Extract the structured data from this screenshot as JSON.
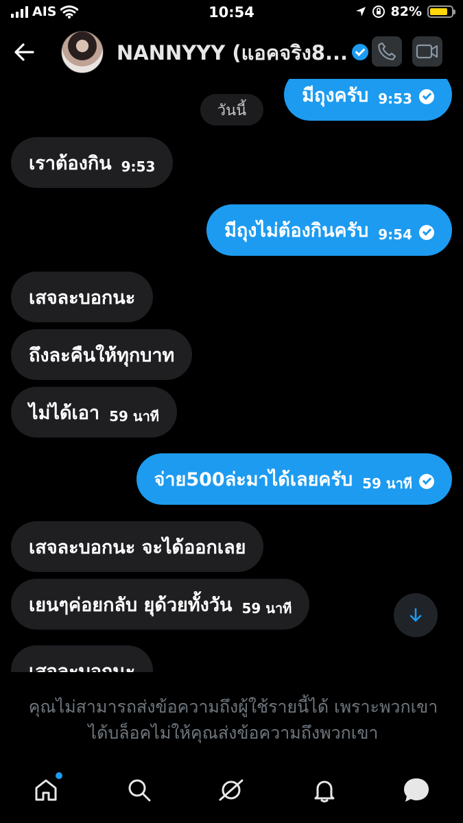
{
  "status_bar": {
    "carrier": "AIS",
    "time": "10:54",
    "battery": "82%",
    "battery_level": 0.82,
    "battery_color": "#ffd60a"
  },
  "header": {
    "title": "NANNYYY (แอคจริง8...",
    "verified": true
  },
  "chat": {
    "date_label": "วันนี้",
    "messages": [
      {
        "dir": "out",
        "text": "มีถุงครับ",
        "time": "9:53",
        "read": true
      },
      {
        "dir": "in",
        "text": "เราต้องกิน",
        "time": "9:53"
      },
      {
        "dir": "out",
        "text": "มีถุงไม่ต้องกินครับ",
        "time": "9:54",
        "read": true
      },
      {
        "dir": "in",
        "text": "เสจละบอกนะ",
        "time": ""
      },
      {
        "dir": "in",
        "text": "ถึงละคืนให้ทุกบาท",
        "time": ""
      },
      {
        "dir": "in",
        "text": "ไม่ได้เอา",
        "time": "59 นาที"
      },
      {
        "dir": "out",
        "text": "จ่าย500ล่ะมาได้เลยครับ",
        "time": "59 นาที",
        "read": true
      },
      {
        "dir": "in",
        "text": "เสจละบอกนะ จะได้ออกเลย",
        "time": ""
      },
      {
        "dir": "in",
        "text": "เยนๆค่อยกลับ ยุด้วยทั้งวัน",
        "time": "59 นาที"
      },
      {
        "dir": "in",
        "text": "เสจละบอกนะ",
        "time": ""
      }
    ]
  },
  "blocked_notice": "คุณไม่สามารถส่งข้อความถึงผู้ใช้รายนี้ได้ เพราะพวกเขาได้บล็อคไม่ให้คุณส่งข้อความถึงพวกเขา",
  "nav": {
    "items": [
      "home-icon",
      "search-icon",
      "spaces-icon",
      "bell-icon",
      "messages-icon"
    ],
    "home_has_notification": true
  },
  "colors": {
    "accent": "#1d9bf0",
    "incoming_bubble": "#1f1f22",
    "background": "#000000"
  }
}
